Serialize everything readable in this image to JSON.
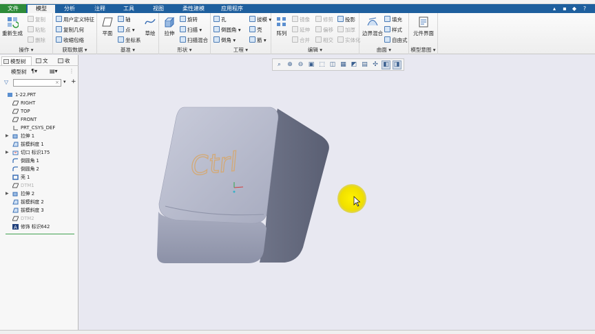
{
  "menu": {
    "tabs": [
      "文件",
      "模型",
      "分析",
      "注释",
      "工具",
      "视图",
      "柔性建模",
      "应用程序"
    ],
    "active": "模型"
  },
  "ribbon": {
    "operations": {
      "title": "操作",
      "regenerate": "重新生成",
      "copy": "复制",
      "paste": "粘贴",
      "delete": "删除"
    },
    "get_data": {
      "title": "获取数据",
      "udf": "用户定义特征",
      "copy_geometry": "复制几何",
      "shrinkwrap": "收缩包络"
    },
    "datum": {
      "title": "基准",
      "plane": "平面",
      "axis": "轴",
      "point": "点",
      "csys": "坐标系",
      "sketch": "草绘"
    },
    "shapes": {
      "title": "形状",
      "extrude": "拉伸",
      "revolve": "旋转",
      "sweep": "扫描",
      "swept_blend": "扫描混合"
    },
    "engineering": {
      "title": "工程",
      "hole": "孔",
      "round": "倒圆角",
      "chamfer": "倒角",
      "draft": "拔模",
      "shell": "壳",
      "rib": "筋"
    },
    "editing": {
      "title": "编辑",
      "pattern": "阵列",
      "mirror": "镜像",
      "extend": "延伸",
      "project": "投影",
      "trim": "修剪",
      "offset": "偏移",
      "thicken": "加厚",
      "merge": "合并",
      "intersect": "相交",
      "solidify": "实体化"
    },
    "surfaces": {
      "title": "曲面",
      "boundary_blend": "边界混合",
      "fill": "填充",
      "style": "样式",
      "freestyle": "自由式"
    },
    "model_intent": {
      "title": "模型意图",
      "component_interface": "元件界面"
    }
  },
  "left_panel": {
    "tabs": [
      "模型树",
      "文",
      "收"
    ],
    "tree_label": "模型树",
    "filter_placeholder": "",
    "items": [
      {
        "label": "1-22.PRT",
        "icon": "part-icon",
        "expand": "",
        "indent": 0,
        "dim": false
      },
      {
        "label": "RIGHT",
        "icon": "datum-plane-icon",
        "expand": "",
        "indent": 1,
        "dim": false
      },
      {
        "label": "TOP",
        "icon": "datum-plane-icon",
        "expand": "",
        "indent": 1,
        "dim": false
      },
      {
        "label": "FRONT",
        "icon": "datum-plane-icon",
        "expand": "",
        "indent": 1,
        "dim": false
      },
      {
        "label": "PRT_CSYS_DEF",
        "icon": "csys-icon",
        "expand": "",
        "indent": 1,
        "dim": false
      },
      {
        "label": "拉伸 1",
        "icon": "extrude-icon",
        "expand": "▶",
        "indent": 1,
        "dim": false
      },
      {
        "label": "拔模斜度 1",
        "icon": "draft-icon",
        "expand": "",
        "indent": 1,
        "dim": false
      },
      {
        "label": "切口 标识175",
        "icon": "cut-icon",
        "expand": "▶",
        "indent": 1,
        "dim": false
      },
      {
        "label": "倒圆角 1",
        "icon": "round-icon",
        "expand": "",
        "indent": 1,
        "dim": false
      },
      {
        "label": "倒圆角 2",
        "icon": "round-icon",
        "expand": "",
        "indent": 1,
        "dim": false
      },
      {
        "label": "壳 1",
        "icon": "shell-icon",
        "expand": "",
        "indent": 1,
        "dim": false
      },
      {
        "label": "DTM1",
        "icon": "datum-plane-icon",
        "expand": "",
        "indent": 1,
        "dim": true
      },
      {
        "label": "拉伸 2",
        "icon": "extrude-icon",
        "expand": "▶",
        "indent": 1,
        "dim": false
      },
      {
        "label": "拔模斜度 2",
        "icon": "draft-icon",
        "expand": "",
        "indent": 1,
        "dim": false
      },
      {
        "label": "拔模斜度 3",
        "icon": "draft-icon",
        "expand": "",
        "indent": 1,
        "dim": false
      },
      {
        "label": "DTM2",
        "icon": "datum-plane-icon",
        "expand": "",
        "indent": 1,
        "dim": true
      },
      {
        "label": "修饰 标识642",
        "icon": "cosmetic-icon",
        "expand": "",
        "indent": 1,
        "dim": false
      }
    ]
  },
  "viewport": {
    "model_text": "Ctrl",
    "toolbar_icons": [
      "refit-icon",
      "zoom-in-icon",
      "zoom-out-icon",
      "repaint-icon",
      "view-orient-icon",
      "saved-views-icon",
      "display-style-icon",
      "perspective-icon",
      "datum-display-icon",
      "spin-center-icon",
      "annotation-display-icon",
      "csys-display-icon"
    ]
  },
  "colors": {
    "menubar": "#1e5f9e",
    "file_tab": "#2e8b3a",
    "viewport_bg": "#e8e8f1",
    "model_body": "#a6abbd",
    "cursor_highlight": "#f2e400"
  }
}
